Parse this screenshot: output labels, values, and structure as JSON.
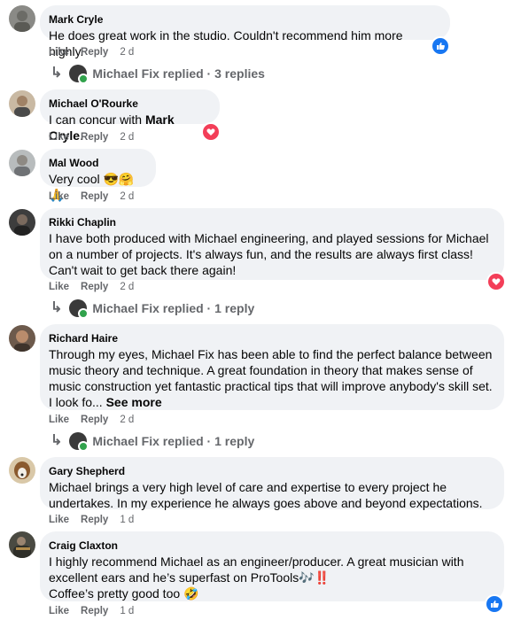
{
  "comments": [
    {
      "name": "Mark Cryle",
      "text": "He does great work in the studio. Couldn't recommend him more highly.",
      "like": "Like",
      "reply": "Reply",
      "time": "2 d",
      "reaction": "like-icon",
      "replies": {
        "author": "Michael Fix",
        "label": "replied · 3 replies"
      }
    },
    {
      "name": "Michael O'Rourke",
      "text_pre": "I can concur with ",
      "text_mention": "Mark Cryle",
      "text_post": ".",
      "like": "Like",
      "reply": "Reply",
      "time": "2 d",
      "reaction": "love-icon"
    },
    {
      "name": "Mal Wood",
      "text": "Very cool 😎🤗🙏",
      "like": "Like",
      "reply": "Reply",
      "time": "2 d"
    },
    {
      "name": "Rikki Chaplin",
      "text": "I have both produced with Michael engineering, and played sessions for Michael on a number of projects. It's always fun, and the results are always first class! Can't wait to get back there again!",
      "like": "Like",
      "reply": "Reply",
      "time": "2 d",
      "reaction": "love-icon",
      "replies": {
        "author": "Michael Fix",
        "label": "replied · 1 reply"
      }
    },
    {
      "name": "Richard Haire",
      "text": "Through my eyes, Michael Fix has been able to find the perfect balance between music theory and technique. A great foundation in theory that makes sense of music construction yet fantastic practical tips that will improve anybody's skill set. I look fo...",
      "see_more": "See more",
      "like": "Like",
      "reply": "Reply",
      "time": "2 d",
      "replies": {
        "author": "Michael Fix",
        "label": "replied · 1 reply"
      }
    },
    {
      "name": "Gary Shepherd",
      "text": "Michael brings a very high level of care and expertise to every project he undertakes. In my experience he always goes above and beyond expectations.",
      "like": "Like",
      "reply": "Reply",
      "time": "1 d"
    },
    {
      "name": "Craig Claxton",
      "text": "I highly recommend Michael as an engineer/producer. A great musician with excellent ears and he’s superfast on ProTools🎶‼️",
      "text2": "Coffee’s pretty good too 🤣",
      "like": "Like",
      "reply": "Reply",
      "time": "1 d",
      "reaction": "like-icon"
    }
  ],
  "colors": {
    "bubble": "#f0f2f5",
    "meta": "#65676b",
    "like": "#1877f2",
    "love": "#f33e58",
    "online": "#31a24c"
  }
}
